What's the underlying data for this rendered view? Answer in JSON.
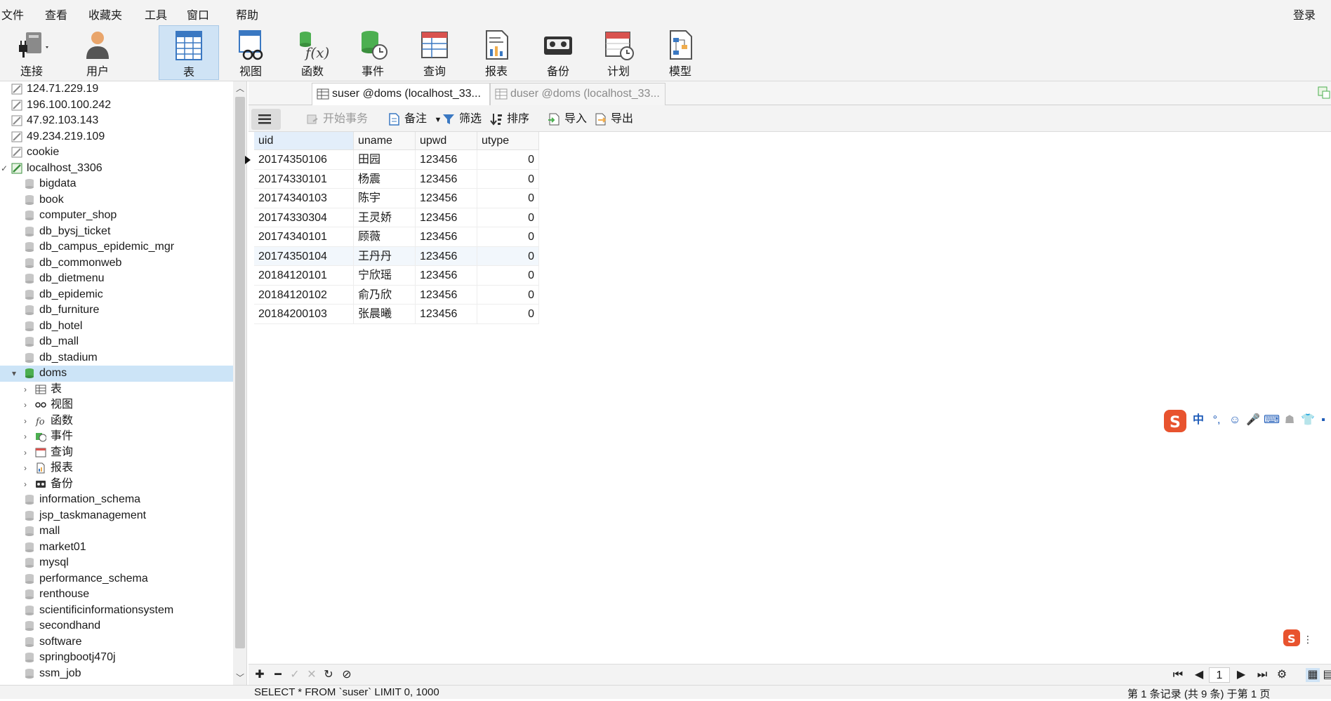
{
  "menu": [
    "文件",
    "查看",
    "收藏夹",
    "工具",
    "窗口",
    "帮助"
  ],
  "login": "登录",
  "toolbar": [
    {
      "label": "连接",
      "icon": "plug-icon"
    },
    {
      "label": "用户",
      "icon": "user-icon"
    },
    {
      "label": "表",
      "icon": "table-icon",
      "active": true
    },
    {
      "label": "视图",
      "icon": "view-icon"
    },
    {
      "label": "函数",
      "icon": "function-icon"
    },
    {
      "label": "事件",
      "icon": "event-icon"
    },
    {
      "label": "查询",
      "icon": "query-icon"
    },
    {
      "label": "报表",
      "icon": "report-icon"
    },
    {
      "label": "备份",
      "icon": "backup-icon"
    },
    {
      "label": "计划",
      "icon": "schedule-icon"
    },
    {
      "label": "模型",
      "icon": "model-icon"
    }
  ],
  "sidebar": {
    "connections": [
      "124.71.229.19",
      "196.100.100.242",
      "47.92.103.143",
      "49.234.219.109",
      "cookie"
    ],
    "active_connection": "localhost_3306",
    "databases_before": [
      "bigdata",
      "book",
      "computer_shop",
      "db_bysj_ticket",
      "db_campus_epidemic_mgr",
      "db_commonweb",
      "db_dietmenu",
      "db_epidemic",
      "db_furniture",
      "db_hotel",
      "db_mall",
      "db_stadium"
    ],
    "selected_db": "doms",
    "db_children": [
      {
        "label": "表",
        "icon": "table-icon"
      },
      {
        "label": "视图",
        "icon": "view-icon"
      },
      {
        "label": "函数",
        "icon": "function-icon"
      },
      {
        "label": "事件",
        "icon": "event-icon"
      },
      {
        "label": "查询",
        "icon": "query-icon"
      },
      {
        "label": "报表",
        "icon": "report-icon"
      },
      {
        "label": "备份",
        "icon": "backup-icon"
      }
    ],
    "databases_after": [
      "information_schema",
      "jsp_taskmanagement",
      "mall",
      "market01",
      "mysql",
      "performance_schema",
      "renthouse",
      "scientificinformationsystem",
      "secondhand",
      "software",
      "springbootj470j",
      "ssm_job"
    ]
  },
  "tabs": [
    {
      "label": "suser @doms (localhost_33...",
      "active": true
    },
    {
      "label": "duser @doms (localhost_33...",
      "active": false
    }
  ],
  "subtoolbar": {
    "begin_tx": "开始事务",
    "note": "备注",
    "filter": "筛选",
    "sort": "排序",
    "import": "导入",
    "export": "导出"
  },
  "grid": {
    "columns": [
      "uid",
      "uname",
      "upwd",
      "utype"
    ],
    "rows": [
      [
        "20174350106",
        "田园",
        "123456",
        "0"
      ],
      [
        "20174330101",
        "杨震",
        "123456",
        "0"
      ],
      [
        "20174340103",
        "陈宇",
        "123456",
        "0"
      ],
      [
        "20174330304",
        "王灵娇",
        "123456",
        "0"
      ],
      [
        "20174340101",
        "顾薇",
        "123456",
        "0"
      ],
      [
        "20174350104",
        "王丹丹",
        "123456",
        "0"
      ],
      [
        "20184120101",
        "宁欣瑶",
        "123456",
        "0"
      ],
      [
        "20184120102",
        "俞乃欣",
        "123456",
        "0"
      ],
      [
        "20184200103",
        "张晨曦",
        "123456",
        "0"
      ]
    ]
  },
  "pager": {
    "page": "1"
  },
  "status": {
    "sql": "SELECT * FROM `suser` LIMIT 0, 1000",
    "records": "第 1 条记录 (共 9 条) 于第 1 页"
  },
  "ime": {
    "lang": "中"
  }
}
